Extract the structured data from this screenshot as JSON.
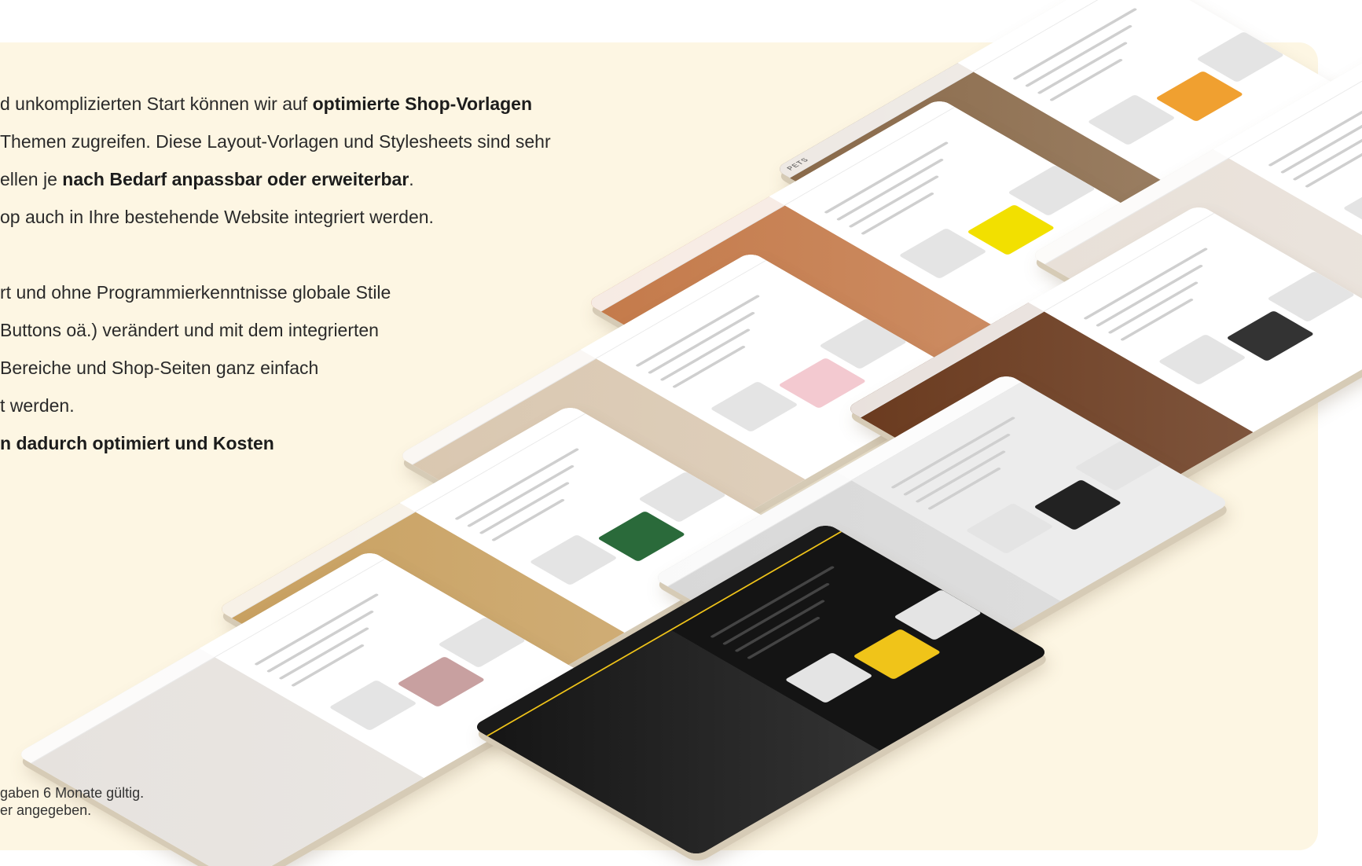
{
  "colors": {
    "panel_bg": "#fdf6e3",
    "text": "#2a2a2a",
    "card_shadow": "#d6cbb6",
    "accent_yellow": "#f2e000",
    "gym_black": "#141414",
    "gym_yellow": "#f0c419"
  },
  "copy": {
    "l1_a": "d unkomplizierten Start können wir auf ",
    "l1_b": "optimierte  Shop-Vorlagen",
    "l2": "Themen zugreifen. Diese Layout-Vorlagen und Stylesheets sind sehr",
    "l3_a": "ellen je ",
    "l3_b": "nach Bedarf anpassbar oder erweiterbar",
    "l3_c": ".",
    "l4": "op auch in Ihre bestehende Website integriert werden.",
    "l5": "rt und ohne Programmierkenntnisse globale Stile",
    "l6": "Buttons oä.) verändert und mit dem integrierten",
    "l7": " Bereiche und Shop-Seiten ganz einfach",
    "l8": "t werden.",
    "l9": "n dadurch optimiert und Kosten"
  },
  "footnote": {
    "l1": "gaben 6 Monate gültig.",
    "l2": "er angegeben."
  },
  "mockups": [
    {
      "name": "pet-shop",
      "hero": "#8a6a4a",
      "side": "#ffffff",
      "accent": "#f0a030",
      "brand": "PETS"
    },
    {
      "name": "tshirt-shop",
      "hero": "#c47a4a",
      "side": "#ffffff",
      "accent": "#f2e000",
      "brand": ""
    },
    {
      "name": "pharmacy-shop",
      "hero": "#e8e0d8",
      "side": "#ffffff",
      "accent": "#c8202a",
      "brand": ""
    },
    {
      "name": "jewelry-shop",
      "hero": "#d9c7b0",
      "side": "#ffffff",
      "accent": "#f3c9d0",
      "brand": ""
    },
    {
      "name": "landscape-shop",
      "hero": "#6a3a1e",
      "side": "#ffffff",
      "accent": "#333333",
      "brand": ""
    },
    {
      "name": "wheat-shop",
      "hero": "#c8a060",
      "side": "#ffffff",
      "accent": "#2a6a3a",
      "brand": ""
    },
    {
      "name": "music-shop",
      "hero": "#d8d8d8",
      "side": "#ececec",
      "accent": "#222222",
      "brand": ""
    },
    {
      "name": "flower-shop",
      "hero": "#e6e2de",
      "side": "#ffffff",
      "accent": "#c8a0a0",
      "brand": ""
    },
    {
      "name": "gym-shop",
      "hero": "#141414",
      "side": "#141414",
      "accent": "#f0c419",
      "brand": ""
    }
  ]
}
